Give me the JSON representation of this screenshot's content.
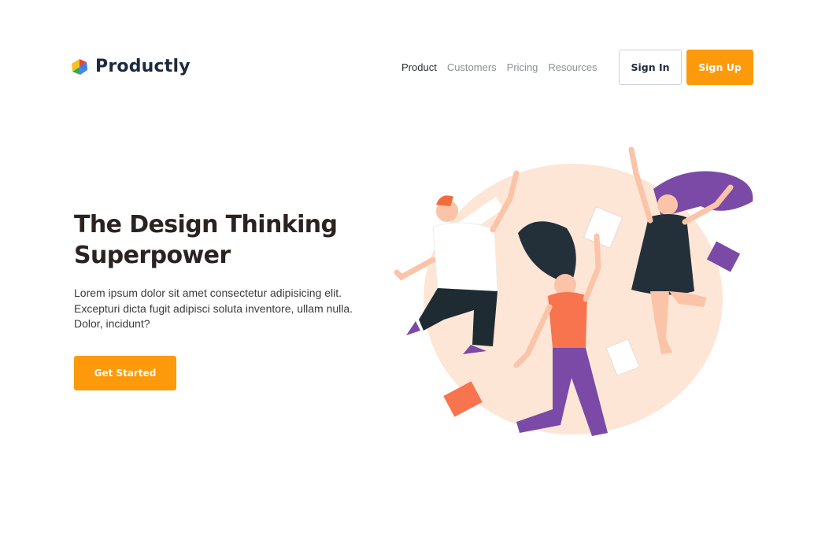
{
  "brand": {
    "name": "Productly",
    "logo_colors": [
      "#f4c21f",
      "#34a853",
      "#4285f4",
      "#ea4335"
    ]
  },
  "nav": {
    "items": [
      {
        "label": "Product",
        "active": true
      },
      {
        "label": "Customers",
        "active": false
      },
      {
        "label": "Pricing",
        "active": false
      },
      {
        "label": "Resources",
        "active": false
      }
    ]
  },
  "auth": {
    "signin_label": "Sign In",
    "signup_label": "Sign Up"
  },
  "hero": {
    "title_line1": "The Design Thinking",
    "title_line2": "Superpower",
    "description": "Lorem ipsum dolor sit amet consectetur adipisicing elit. Excepturi dicta fugit adipisci soluta inventore, ullam nulla. Dolor, incidunt?",
    "cta_label": "Get Started"
  },
  "colors": {
    "accent": "#fd9a0b",
    "heading": "#2a2320",
    "blob": "#fde6d6",
    "purple": "#6f3f97",
    "coral": "#f7744e",
    "dark": "#23303a"
  }
}
